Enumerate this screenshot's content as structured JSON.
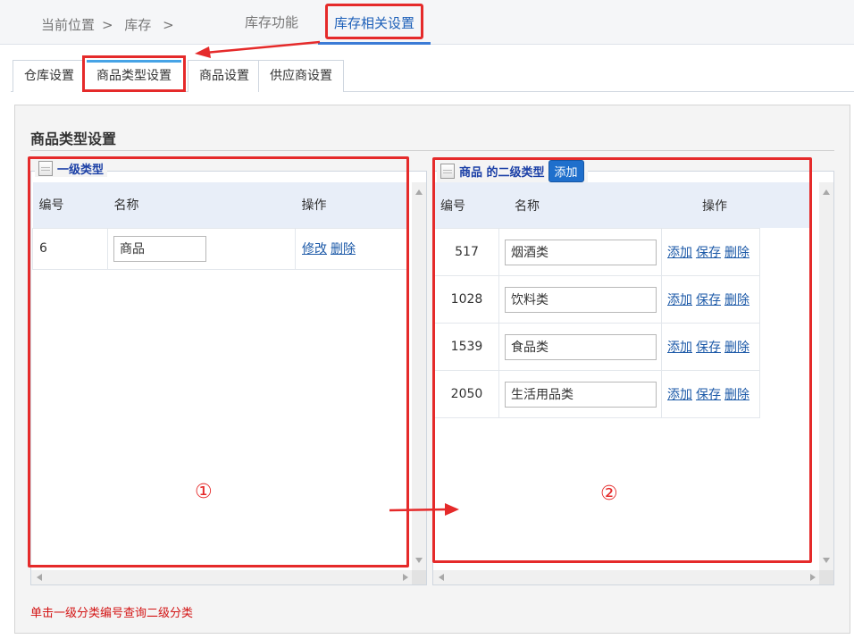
{
  "breadcrumb": {
    "current": "当前位置",
    "sep": ">",
    "item": "库存",
    "sep2": ">"
  },
  "top_tabs": [
    {
      "label": "库存功能"
    },
    {
      "label": "库存相关设置"
    }
  ],
  "sub_tabs": [
    {
      "label": "仓库设置"
    },
    {
      "label": "商品类型设置"
    },
    {
      "label": "商品设置"
    },
    {
      "label": "供应商设置"
    }
  ],
  "panel": {
    "title": "商品类型设置",
    "hint": "单击一级分类编号查询二级分类"
  },
  "level1": {
    "legend": "一级类型",
    "headers": {
      "id": "编号",
      "name": "名称",
      "ops": "操作"
    },
    "rows": [
      {
        "id": "6",
        "name": "商品",
        "edit": "修改",
        "delete": "删除"
      }
    ]
  },
  "level2": {
    "legend": "商品 的二级类型",
    "add_button": "添加",
    "headers": {
      "id": "编号",
      "name": "名称",
      "ops": "操作"
    },
    "rows": [
      {
        "id": "517",
        "name": "烟酒类",
        "add": "添加",
        "save": "保存",
        "delete": "删除"
      },
      {
        "id": "1028",
        "name": "饮料类",
        "add": "添加",
        "save": "保存",
        "delete": "删除"
      },
      {
        "id": "1539",
        "name": "食品类",
        "add": "添加",
        "save": "保存",
        "delete": "删除"
      },
      {
        "id": "2050",
        "name": "生活用品类",
        "add": "添加",
        "save": "保存",
        "delete": "删除"
      }
    ]
  },
  "annotations": {
    "circle1": "①",
    "circle2": "②",
    "accent_color": "#e52a2a"
  },
  "colors": {
    "link": "#1d5aa8",
    "header_bg": "#e8eef8",
    "primary_button": "#1f6fcc",
    "hint": "#d31414"
  }
}
